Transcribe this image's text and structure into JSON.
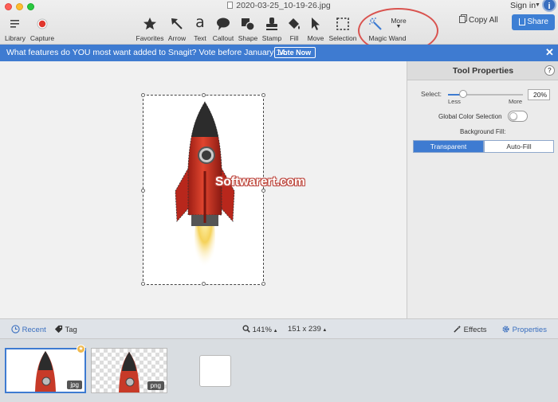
{
  "window": {
    "title": "2020-03-25_10-19-26.jpg",
    "sign_in": "Sign in"
  },
  "toolbar": {
    "left": [
      {
        "label": "Library",
        "icon": "list-icon"
      },
      {
        "label": "Capture",
        "icon": "record-icon"
      }
    ],
    "tools": [
      {
        "label": "Favorites",
        "icon": "star-icon"
      },
      {
        "label": "Arrow",
        "icon": "arrow-icon"
      },
      {
        "label": "Text",
        "icon": "text-icon",
        "glyph": "a"
      },
      {
        "label": "Callout",
        "icon": "callout-icon"
      },
      {
        "label": "Shape",
        "icon": "shape-icon"
      },
      {
        "label": "Stamp",
        "icon": "stamp-icon"
      },
      {
        "label": "Fill",
        "icon": "fill-icon"
      },
      {
        "label": "Move",
        "icon": "move-icon"
      },
      {
        "label": "Selection",
        "icon": "selection-icon"
      },
      {
        "label": "Magic Wand",
        "icon": "magic-wand-icon"
      }
    ],
    "more_label": "More",
    "copy_all": "Copy All",
    "share": "Share"
  },
  "banner": {
    "text": "What features do YOU most want added to Snagit? Vote before January 14.",
    "button": "Vote Now",
    "color": "#3e7bd1"
  },
  "canvas": {
    "watermark": "Softwarert.com"
  },
  "properties": {
    "title": "Tool Properties",
    "help": "?",
    "select_label": "Select:",
    "select_value": 20,
    "select_display": "20%",
    "less": "Less",
    "more": "More",
    "global_color_selection": "Global Color Selection",
    "global_color_selection_on": false,
    "background_fill_label": "Background Fill:",
    "fill_options": [
      "Transparent",
      "Auto-Fill"
    ],
    "fill_selected": "Transparent"
  },
  "statusbar": {
    "recent": "Recent",
    "tag": "Tag",
    "zoom": "141%",
    "dimensions": "151 x 239",
    "effects": "Effects",
    "properties": "Properties"
  },
  "tray": {
    "items": [
      {
        "ext": "jpg",
        "selected": true
      },
      {
        "ext": "png",
        "selected": false
      }
    ]
  },
  "colors": {
    "accent": "#3e7bd1",
    "highlight": "#d9534f"
  }
}
